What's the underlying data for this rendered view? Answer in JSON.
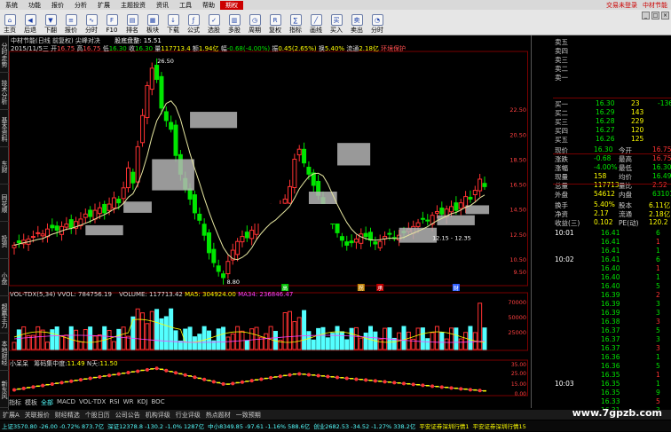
{
  "menu": {
    "items": [
      "系统",
      "功能",
      "报价",
      "分析",
      "扩展",
      "主题投资",
      "资讯",
      "工具",
      "帮助",
      "期权"
    ],
    "right": [
      "交易未登录",
      "中材节能"
    ]
  },
  "toolbar": {
    "buttons": [
      {
        "label": "主页",
        "icon": "home-icon",
        "glyph": "⌂"
      },
      {
        "label": "后退",
        "icon": "back-icon",
        "glyph": "◀"
      },
      {
        "label": "下翻",
        "icon": "page-down-icon",
        "glyph": "▼"
      },
      {
        "label": "报价",
        "icon": "quote-icon",
        "glyph": "≡"
      },
      {
        "label": "分时",
        "icon": "minute-chart-icon",
        "glyph": "∿"
      },
      {
        "label": "F10",
        "icon": "f10-icon",
        "glyph": "F"
      },
      {
        "label": "排名",
        "icon": "rank-icon",
        "glyph": "▤"
      },
      {
        "label": "板块",
        "icon": "sector-icon",
        "glyph": "▦"
      },
      {
        "label": "下载",
        "icon": "download-icon",
        "glyph": "↓"
      },
      {
        "label": "公式",
        "icon": "formula-icon",
        "glyph": "ƒ"
      },
      {
        "label": "选股",
        "icon": "stock-pick-icon",
        "glyph": "✓"
      },
      {
        "label": "多股",
        "icon": "multi-stock-icon",
        "glyph": "▥"
      },
      {
        "label": "周期",
        "icon": "period-icon",
        "glyph": "◷"
      },
      {
        "label": "复权",
        "icon": "adjust-icon",
        "glyph": "R"
      },
      {
        "label": "指标",
        "icon": "indicator-icon",
        "glyph": "∑"
      },
      {
        "label": "画线",
        "icon": "draw-line-icon",
        "glyph": "╱"
      },
      {
        "label": "买入",
        "icon": "buy-icon",
        "glyph": "买"
      },
      {
        "label": "卖出",
        "icon": "sell-icon",
        "glyph": "卖"
      },
      {
        "label": "分时",
        "icon": "minute-icon",
        "glyph": "◔"
      }
    ]
  },
  "sidebar": [
    "分时走势",
    "技术分析",
    "基本资料",
    "东财",
    "同花顺",
    "投资",
    "小盘",
    "超赢主力",
    "本地财经",
    "新东风"
  ],
  "header": {
    "line1": "中材节能(日线 前复权) 尖峰对决",
    "line1_extra": "股底盘整: 15.51",
    "date": "2015/11/5三",
    "o_label": "开",
    "o": "16.75",
    "h_label": "高",
    "h": "16.75",
    "l_label": "低",
    "l": "16.30",
    "c_label": "收",
    "c": "16.30",
    "vol_label": "量",
    "vol": "117713.4",
    "amt_label": "额",
    "amt": "1.94亿",
    "chg_label": "幅",
    "chg": "-0.68(-4.00%)",
    "amp_label": "振",
    "amp": "0.45(2.65%)",
    "turn_label": "换",
    "turn": "5.40%",
    "flow_label": "流通",
    "flow": "2.18亿",
    "env": "环境保护"
  },
  "price_annot": {
    "high": "26.50",
    "low": "8.80",
    "range": "12.15 - 12.35"
  },
  "price_axis": [
    "22.50",
    "20.50",
    "18.50",
    "16.50",
    "14.50",
    "12.50",
    "10.50",
    "9.50"
  ],
  "event_markers": [
    "高",
    "拐",
    "承",
    "财"
  ],
  "volume": {
    "label": "VOL-TDX(5,34)",
    "vvol": "VVOL: 784756.19",
    "volume": "VOLUME: 117713.42",
    "ma5": "MA5: 304924.00",
    "ma34": "MA34: 236846.47",
    "axis": [
      "70000",
      "50000",
      "25000"
    ]
  },
  "indicator": {
    "name": "小呆呆",
    "label": "筹码集中度:",
    "value": "11.49",
    "n_label": "N天:",
    "n": "11.50",
    "axis": [
      "35.00",
      "25.00",
      "15.00",
      "0.00"
    ]
  },
  "indicator_tabs": [
    "指标",
    "模板",
    "全部",
    "MACD",
    "VOL-TDX",
    "RSI",
    "WR",
    "KDJ",
    "BOC"
  ],
  "bottom_tabs": [
    "扩展A",
    "关联报价",
    "财经精选",
    "个股日历",
    "公司公告",
    "机构评级",
    "行业评级",
    "热点题材",
    "一致预期"
  ],
  "status": [
    "上证3570.80 -26.00 -0.72% 873.7亿",
    "深证12378.8 -130.2 -1.0% 1287亿",
    "中小8349.85 -97.61 -1.16% 588.6亿",
    "创业2682.53 -34.52 -1.27% 338.2亿",
    "平安证券深圳行情1",
    "平安证券深圳行情15"
  ],
  "quote": {
    "asks": [
      {
        "label": "卖五",
        "price": "",
        "vol": ""
      },
      {
        "label": "卖四",
        "price": "",
        "vol": ""
      },
      {
        "label": "卖三",
        "price": "",
        "vol": ""
      },
      {
        "label": "卖二",
        "price": "",
        "vol": ""
      },
      {
        "label": "卖一",
        "price": "",
        "vol": ""
      }
    ],
    "bids": [
      {
        "label": "买一",
        "price": "16.30",
        "vol": "23",
        "chg": "-136"
      },
      {
        "label": "买二",
        "price": "16.29",
        "vol": "143",
        "chg": ""
      },
      {
        "label": "买三",
        "price": "16.28",
        "vol": "229",
        "chg": ""
      },
      {
        "label": "买四",
        "price": "16.27",
        "vol": "120",
        "chg": ""
      },
      {
        "label": "买五",
        "price": "16.26",
        "vol": "125",
        "chg": ""
      }
    ],
    "stats": [
      {
        "l1": "现价",
        "v1": "16.30",
        "l2": "今开",
        "v2": "16.75"
      },
      {
        "l1": "涨跌",
        "v1": "-0.68",
        "l2": "最高",
        "v2": "16.75"
      },
      {
        "l1": "涨幅",
        "v1": "-4.00%",
        "l2": "最低",
        "v2": "16.30"
      },
      {
        "l1": "现量",
        "v1": "158",
        "l2": "均价",
        "v2": "16.49"
      },
      {
        "l1": "总量",
        "v1": "117713",
        "l2": "量比",
        "v2": "2.52"
      },
      {
        "l1": "外盘",
        "v1": "54612",
        "l2": "内盘",
        "v2": "63101"
      }
    ],
    "stats2": [
      {
        "l1": "换手",
        "v1": "5.40%",
        "l2": "股本",
        "v2": "6.11亿"
      },
      {
        "l1": "净资",
        "v1": "2.17",
        "l2": "流通",
        "v2": "2.18亿"
      },
      {
        "l1": "收益(三)",
        "v1": "0.102",
        "l2": "PE(动)",
        "v2": "120.2"
      }
    ],
    "ticks": [
      {
        "t": "10:01",
        "p": "16.41",
        "v": "6"
      },
      {
        "t": "",
        "p": "16.41",
        "v": "1"
      },
      {
        "t": "",
        "p": "16.41",
        "v": "1"
      },
      {
        "t": "10:02",
        "p": "16.41",
        "v": "6"
      },
      {
        "t": "",
        "p": "16.40",
        "v": "1"
      },
      {
        "t": "",
        "p": "16.40",
        "v": "1"
      },
      {
        "t": "",
        "p": "16.40",
        "v": "5"
      },
      {
        "t": "",
        "p": "16.39",
        "v": "2"
      },
      {
        "t": "",
        "p": "16.39",
        "v": "3"
      },
      {
        "t": "",
        "p": "16.39",
        "v": "3"
      },
      {
        "t": "",
        "p": "16.38",
        "v": "3"
      },
      {
        "t": "",
        "p": "16.37",
        "v": "5"
      },
      {
        "t": "",
        "p": "16.37",
        "v": "3"
      },
      {
        "t": "",
        "p": "16.37",
        "v": "3"
      },
      {
        "t": "",
        "p": "16.36",
        "v": "1"
      },
      {
        "t": "",
        "p": "16.36",
        "v": "5"
      },
      {
        "t": "",
        "p": "16.35",
        "v": "1"
      },
      {
        "t": "10:03",
        "p": "16.35",
        "v": "1"
      },
      {
        "t": "",
        "p": "16.35",
        "v": "9"
      },
      {
        "t": "",
        "p": "16.33",
        "v": "5"
      },
      {
        "t": "",
        "p": "16.31",
        "v": "3"
      },
      {
        "t": "",
        "p": "16.31",
        "v": "4"
      }
    ]
  },
  "colors": {
    "up": "#ff3232",
    "down": "#00e600",
    "ma": "#e6e6a0",
    "cyan": "#54ffff",
    "yellow": "#ffff00"
  },
  "watermark": "www.7gpzb.com"
}
